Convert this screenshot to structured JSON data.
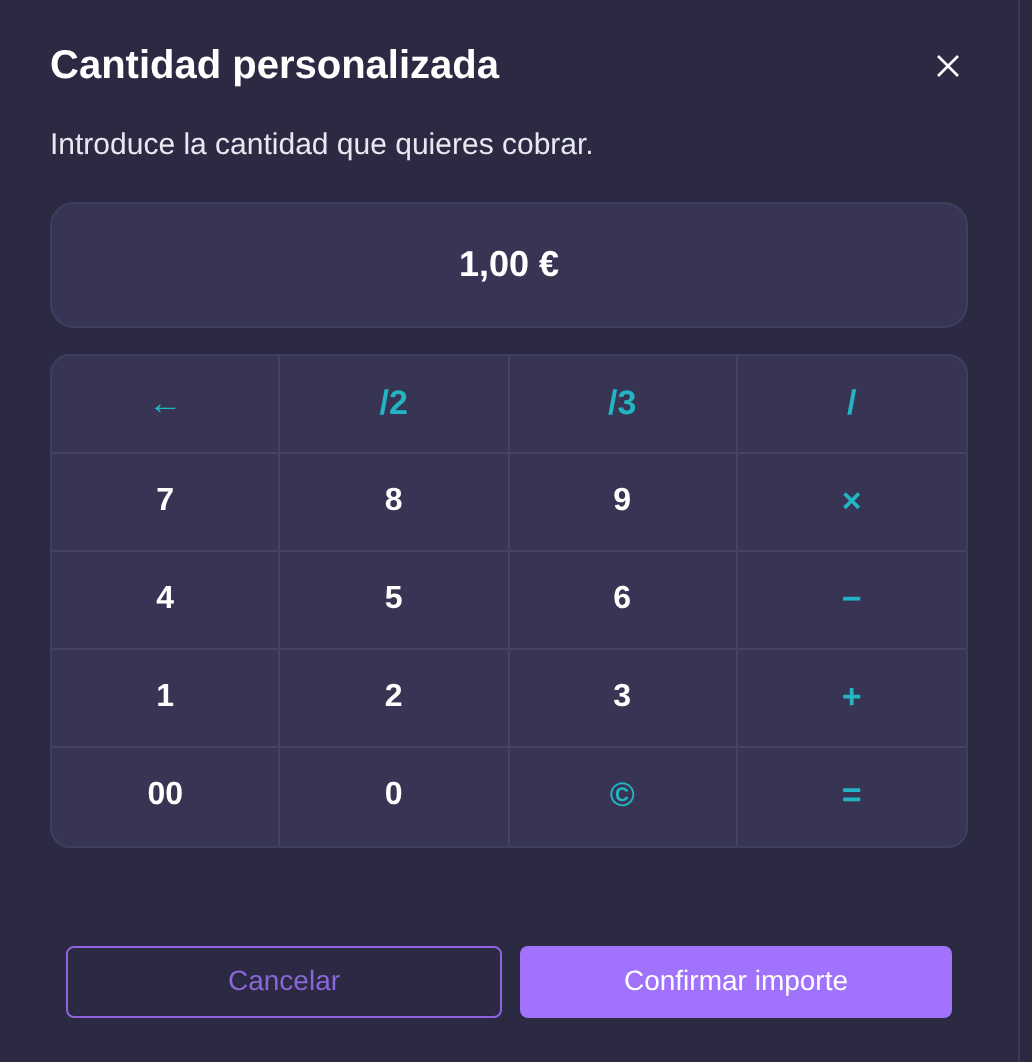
{
  "dialog": {
    "title": "Cantidad personalizada",
    "subtitle": "Introduce la cantidad que quieres cobrar."
  },
  "amount": "1,00 €",
  "keypad": [
    {
      "label": "←",
      "kind": "operator"
    },
    {
      "label": "/2",
      "kind": "operator"
    },
    {
      "label": "/3",
      "kind": "operator"
    },
    {
      "label": "/",
      "kind": "operator"
    },
    {
      "label": "7",
      "kind": "digit"
    },
    {
      "label": "8",
      "kind": "digit"
    },
    {
      "label": "9",
      "kind": "digit"
    },
    {
      "label": "×",
      "kind": "operator"
    },
    {
      "label": "4",
      "kind": "digit"
    },
    {
      "label": "5",
      "kind": "digit"
    },
    {
      "label": "6",
      "kind": "digit"
    },
    {
      "label": "−",
      "kind": "operator"
    },
    {
      "label": "1",
      "kind": "digit"
    },
    {
      "label": "2",
      "kind": "digit"
    },
    {
      "label": "3",
      "kind": "digit"
    },
    {
      "label": "+",
      "kind": "operator"
    },
    {
      "label": "00",
      "kind": "digit"
    },
    {
      "label": "0",
      "kind": "digit"
    },
    {
      "label": "©",
      "kind": "operator"
    },
    {
      "label": "=",
      "kind": "operator"
    }
  ],
  "buttons": [
    {
      "label": "Cancelar",
      "kind": "secondary"
    },
    {
      "label": "Confirmar importe",
      "kind": "primary"
    }
  ]
}
